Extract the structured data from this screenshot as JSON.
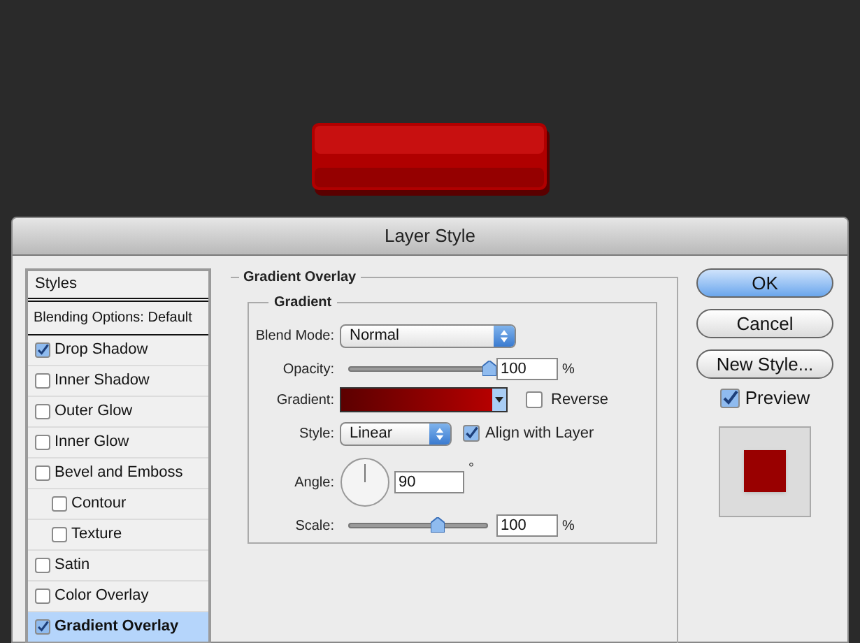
{
  "dialog": {
    "title": "Layer Style"
  },
  "styles_panel": {
    "header": "Styles",
    "blending_options": "Blending Options: Default",
    "items": [
      {
        "label": "Drop Shadow",
        "checked": true,
        "selected": false
      },
      {
        "label": "Inner Shadow",
        "checked": false,
        "selected": false
      },
      {
        "label": "Outer Glow",
        "checked": false,
        "selected": false
      },
      {
        "label": "Inner Glow",
        "checked": false,
        "selected": false
      },
      {
        "label": "Bevel and Emboss",
        "checked": false,
        "selected": false,
        "children": [
          {
            "label": "Contour",
            "checked": false,
            "selected": false
          },
          {
            "label": "Texture",
            "checked": false,
            "selected": false
          }
        ]
      },
      {
        "label": "Satin",
        "checked": false,
        "selected": false
      },
      {
        "label": "Color Overlay",
        "checked": false,
        "selected": false
      },
      {
        "label": "Gradient Overlay",
        "checked": true,
        "selected": true
      }
    ]
  },
  "gradient_overlay": {
    "title": "Gradient Overlay",
    "group_title": "Gradient",
    "blend_mode": {
      "label": "Blend Mode:",
      "value": "Normal"
    },
    "opacity": {
      "label": "Opacity:",
      "level": 1.0,
      "value": "100",
      "unit": "%"
    },
    "gradient": {
      "label": "Gradient:",
      "reverse_label": "Reverse",
      "reverse": false
    },
    "style": {
      "label": "Style:",
      "value": "Linear",
      "align_label": "Align with Layer",
      "align_with_layer": true
    },
    "angle": {
      "label": "Angle:",
      "value": "90",
      "unit": "°"
    },
    "scale": {
      "label": "Scale:",
      "level": 0.63,
      "value": "100",
      "unit": "%"
    }
  },
  "buttons": [
    {
      "label": "OK",
      "default": true
    },
    {
      "label": "Cancel",
      "default": false
    },
    {
      "label": "New Style...",
      "default": false
    }
  ],
  "preview": {
    "label": "Preview",
    "checked": true
  }
}
